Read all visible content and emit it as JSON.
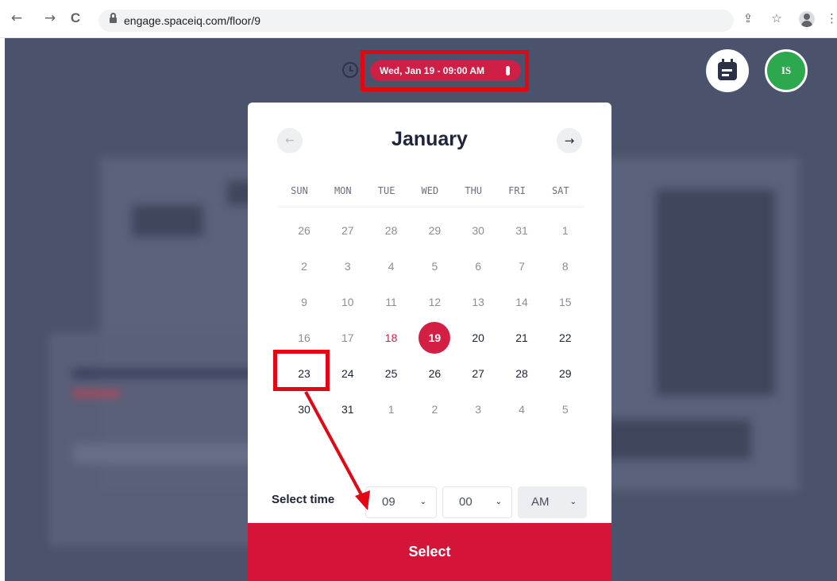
{
  "browser": {
    "url": "engage.spaceiq.com/floor/9",
    "back_glyph": "←",
    "forward_glyph": "→",
    "reload_glyph": "C",
    "share_glyph": "⇪",
    "star_glyph": "☆",
    "menu_glyph": "⋮"
  },
  "header": {
    "date_time": "Wed, Jan 19 - 09:00 AM",
    "avatar_initials": "IS",
    "avatar_color": "#2ea84f",
    "accent_color": "#d41f45"
  },
  "calendar": {
    "month": "January",
    "prev_glyph": "←",
    "next_glyph": "→",
    "weekdays": [
      "SUN",
      "MON",
      "TUE",
      "WED",
      "THU",
      "FRI",
      "SAT"
    ],
    "days": [
      [
        "26",
        "27",
        "28",
        "29",
        "30",
        "31",
        "1"
      ],
      [
        "2",
        "3",
        "4",
        "5",
        "6",
        "7",
        "8"
      ],
      [
        "9",
        "10",
        "11",
        "12",
        "13",
        "14",
        "15"
      ],
      [
        "16",
        "17",
        "18",
        "19",
        "20",
        "21",
        "22"
      ],
      [
        "23",
        "24",
        "25",
        "26",
        "27",
        "28",
        "29"
      ],
      [
        "30",
        "31",
        "1",
        "2",
        "3",
        "4",
        "5"
      ]
    ],
    "today": "18",
    "selected": "19"
  },
  "time": {
    "label": "Select time",
    "hour": "09",
    "minute": "00",
    "period": "AM",
    "chevron": "⌄"
  },
  "select_button": "Select"
}
